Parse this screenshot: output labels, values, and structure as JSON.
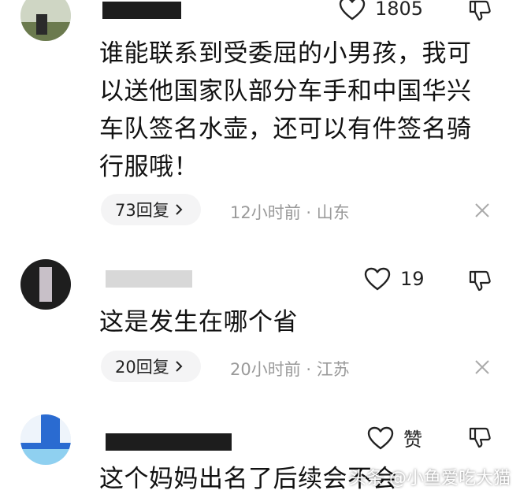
{
  "comments": [
    {
      "likes": "1805",
      "text_lines": [
        "谁能联系到受委屈的小男孩，我可",
        "以送他国家队部分车手和中国华兴",
        "车队签名水壶，还可以有件签名骑",
        "行服哦！"
      ],
      "reply_label": "73回复",
      "meta": "12小时前 · 山东"
    },
    {
      "likes": "19",
      "text_lines": [
        "这是发生在哪个省"
      ],
      "reply_label": "20回复",
      "meta": "20小时前 · 江苏"
    },
    {
      "likes": "赞",
      "text_lines": [
        "这个妈妈出名了后续会不会"
      ]
    }
  ],
  "watermark": "头条 @小鱼爱吃大猫"
}
